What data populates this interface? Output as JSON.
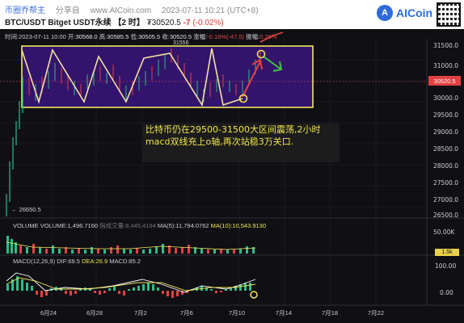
{
  "header": {
    "source": "币圈乔帮主",
    "share_to": "分享自",
    "site": "www.AICoin.com",
    "timestamp": "2023-07-11 10:21 (UTC+8)",
    "symbol": "BTC/USDT Bitget USDT永续",
    "interval": "【2 时】",
    "price": "₮30520.5",
    "change": "-7",
    "change_pct": "(-0.02%)"
  },
  "logo": {
    "mark": "A",
    "text": "AICoin"
  },
  "ohlc": {
    "time": "时间:2023-07-11 10:00",
    "open_label": "开:",
    "open": "30568.0",
    "high_label": "高:",
    "high": "30585.5",
    "low_label": "低:",
    "low": "30505.5",
    "close_label": "收:",
    "close": "30520.5",
    "chg_label": "涨幅:",
    "chg": "-0.16%(-47.5)",
    "amp_label": "振幅:",
    "amp": "0.26%"
  },
  "annotation": {
    "line1": "比特币仍在29500-31500大区间震荡,2小时",
    "line2": "macd双线充上o轴,再次站稳3万关口."
  },
  "price_axis": [
    "31500.0",
    "31000.0",
    "30500.0",
    "30000.0",
    "29500.0",
    "29000.0",
    "28500.0",
    "28000.0",
    "27500.0",
    "27000.0",
    "26500.0"
  ],
  "current_price_tag": "30520.5",
  "low_marker": "← 26650.5",
  "high_marker": "31556",
  "volume": {
    "label": "VOLUME",
    "volume": "VOLUME:1,496.7160",
    "quote": "指成交量:8,445.4194",
    "ma5": "MA(5):11,794.0762",
    "ma10": "MA(10):10,543.9130",
    "axis_top": "50.00K",
    "axis_bottom": "1.5k"
  },
  "macd": {
    "label": "MACD(12,26,9)",
    "dif": "DIF:69.5",
    "dea": "DEA:26.9",
    "macd": "MACD:85.2",
    "axis_top": "100.00",
    "axis_mid": "0.00"
  },
  "dates": [
    "6月24",
    "6月28",
    "7月2",
    "7月6",
    "7月10",
    "7月14",
    "7月18",
    "7月22"
  ],
  "colors": {
    "up": "#2ebd85",
    "down": "#e14141",
    "annotation": "#f0e44a",
    "box": "#4a1fa0"
  }
}
